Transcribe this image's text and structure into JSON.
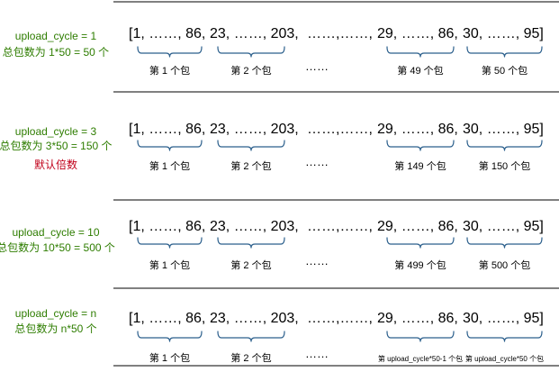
{
  "colors": {
    "label_green": "#2e7d00",
    "note_red": "#c0001a",
    "brace_blue": "#2b5f8c"
  },
  "array_segments": [
    "[1, ……, 86,",
    "23, ……, 203,",
    "……,……,",
    "29, ……, 86,",
    "30, ……, 95]"
  ],
  "middle_ellipsis": "……",
  "sections": [
    {
      "cycle_label": "upload_cycle = 1",
      "count_label": "总包数为 1*50 = 50 个",
      "note": "",
      "packets": [
        "第 1 个包",
        "第 2 个包",
        "第 49 个包",
        "第 50 个包"
      ]
    },
    {
      "cycle_label": "upload_cycle = 3",
      "count_label": "总包数为 3*50 = 150 个",
      "note": "默认倍数",
      "packets": [
        "第 1 个包",
        "第 2 个包",
        "第 149 个包",
        "第 150 个包"
      ]
    },
    {
      "cycle_label": "upload_cycle = 10",
      "count_label": "总包数为 10*50 = 500 个",
      "note": "",
      "packets": [
        "第 1 个包",
        "第 2 个包",
        "第 499 个包",
        "第 500 个包"
      ]
    },
    {
      "cycle_label": "upload_cycle = n",
      "count_label": "总包数为 n*50 个",
      "note": "",
      "packets": [
        "第 1 个包",
        "第 2 个包",
        "第 upload_cycle*50-1 个包",
        "第 upload_cycle*50 个包"
      ]
    }
  ]
}
